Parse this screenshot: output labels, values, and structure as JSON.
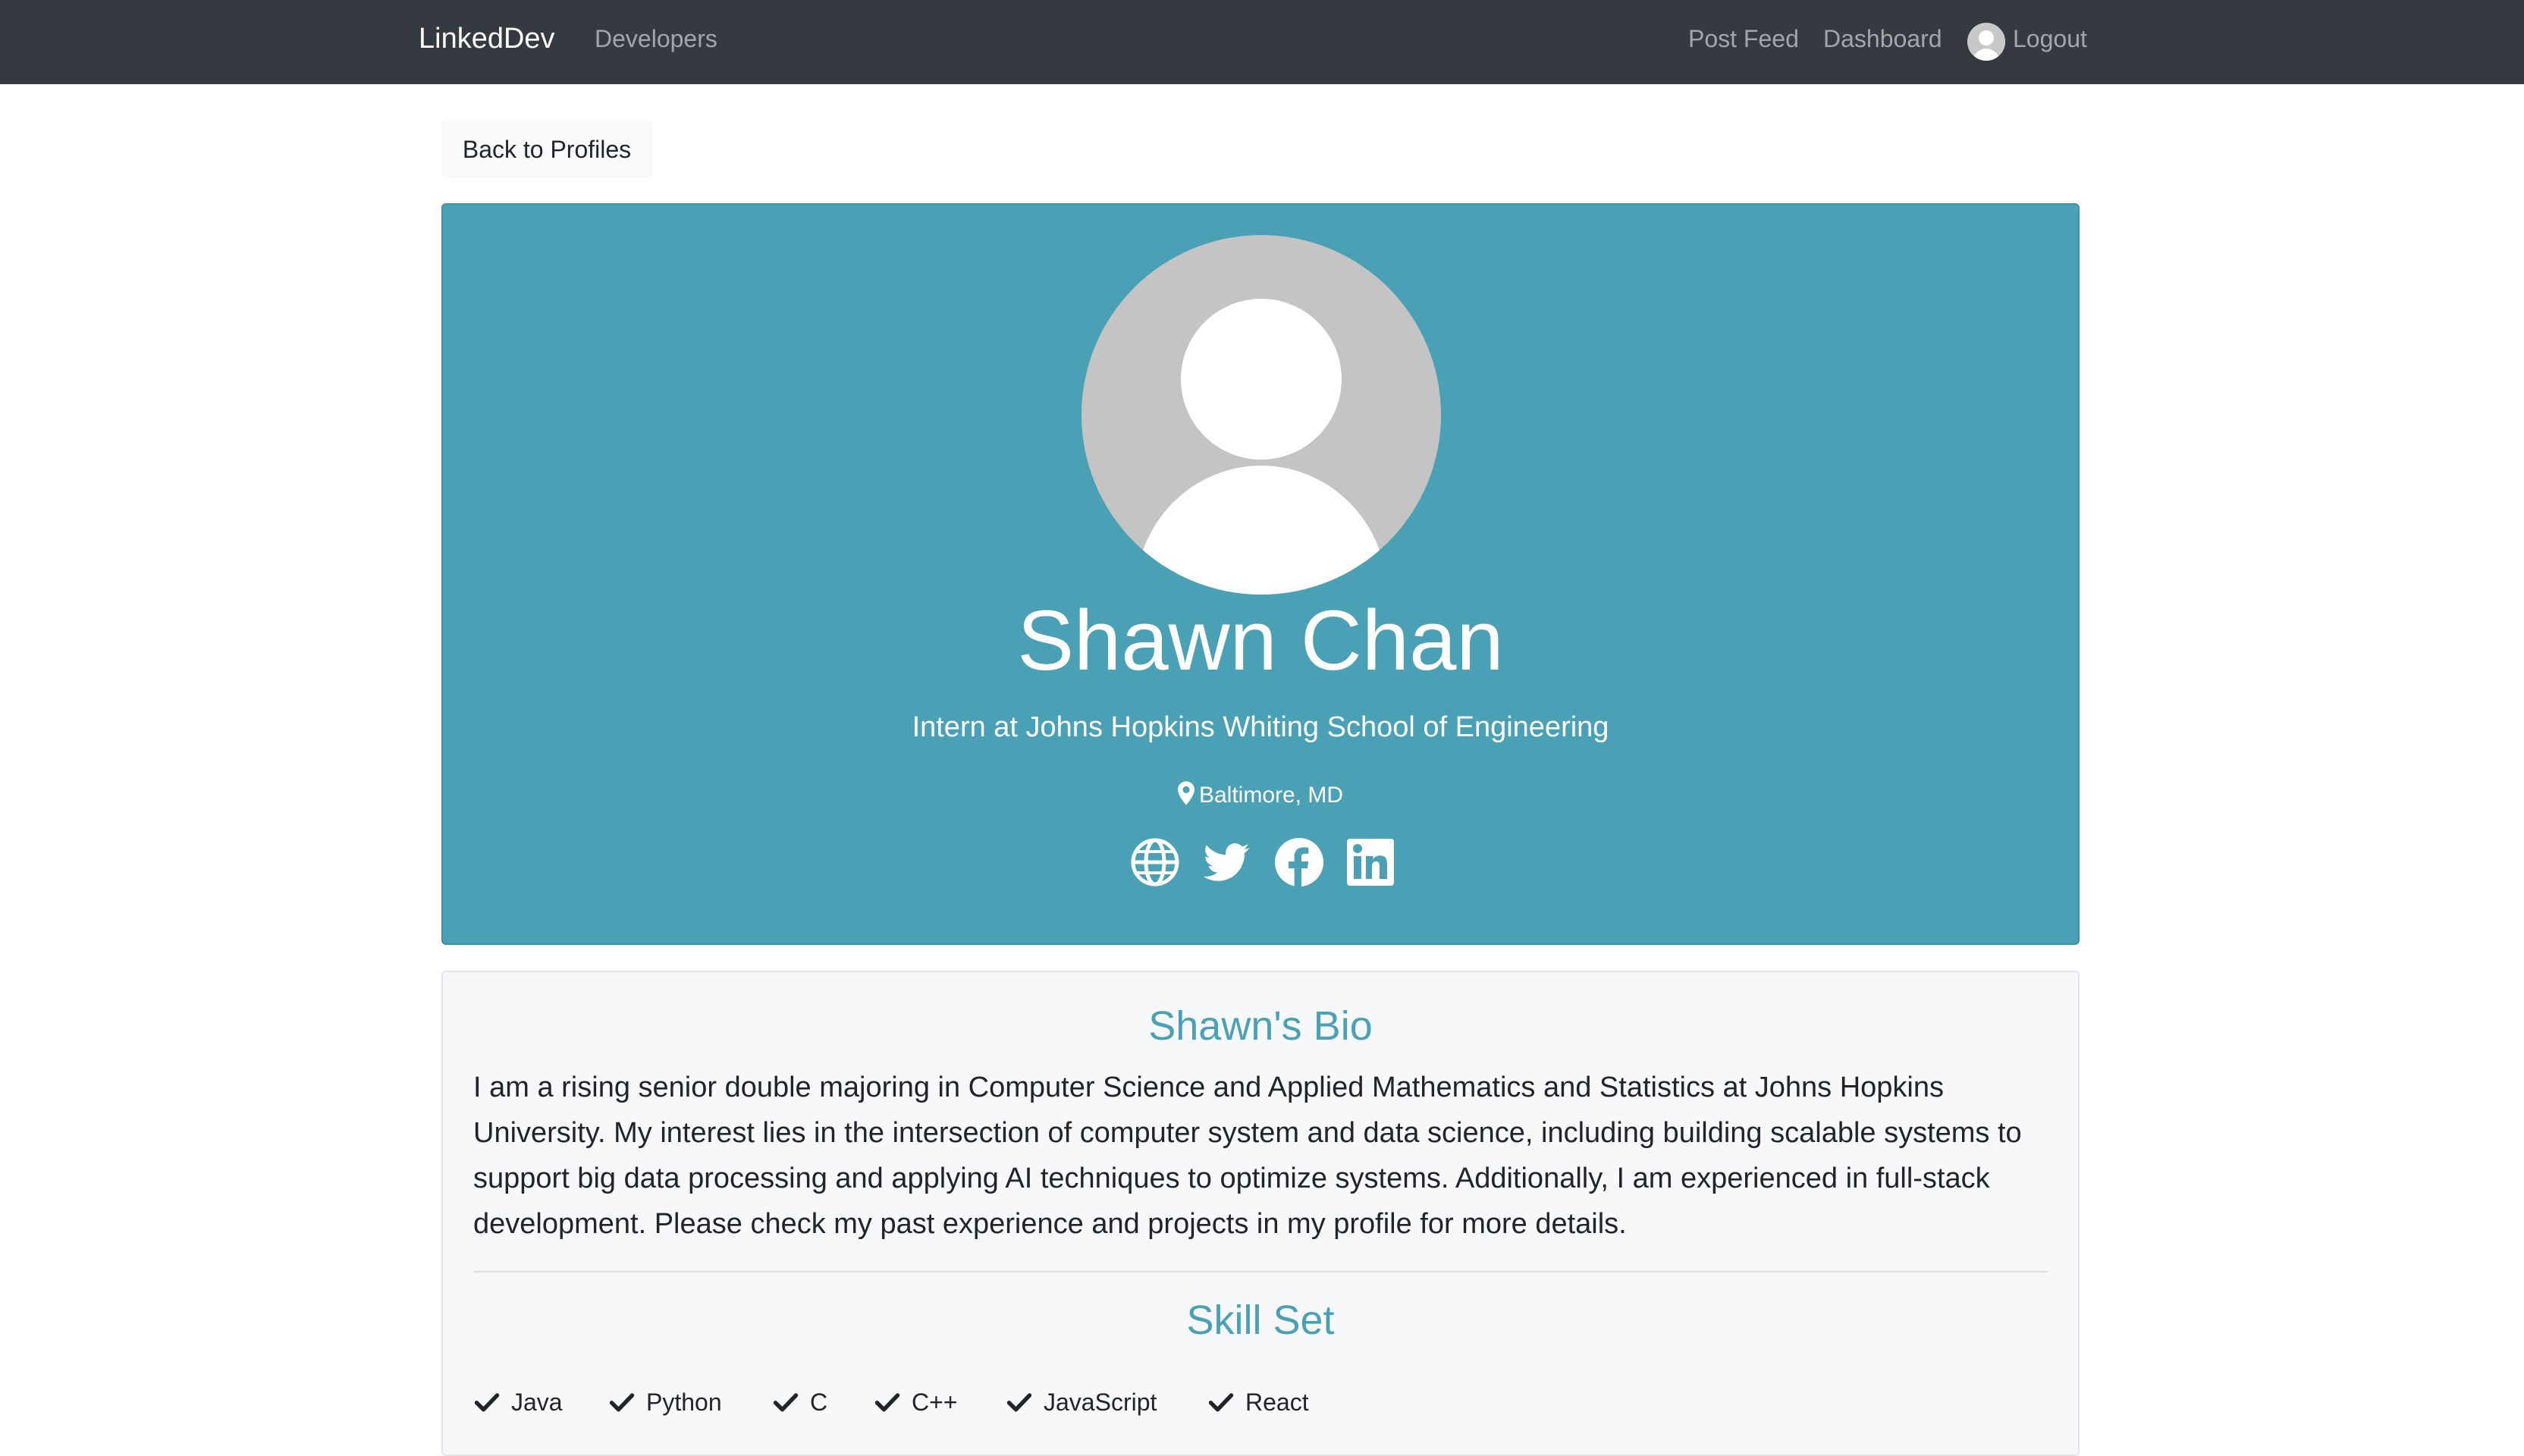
{
  "navbar": {
    "brand": "LinkedDev",
    "developers": "Developers",
    "post_feed": "Post Feed",
    "dashboard": "Dashboard",
    "logout": "Logout",
    "bg_color": "#343a40"
  },
  "back_button": "Back to Profiles",
  "profile": {
    "name": "Shawn Chan",
    "title": "Intern at Johns Hopkins Whiting School of Engineering",
    "location": "Baltimore, MD",
    "social_icons": [
      "globe-icon",
      "twitter-icon",
      "facebook-icon",
      "linkedin-icon"
    ],
    "accent_color": "#4aa0b5"
  },
  "bio": {
    "heading": "Shawn's Bio",
    "lines": [
      "I am a rising senior double majoring in Computer Science and Applied Mathematics and Statistics at Johns Hopkins",
      "University. My interest lies in the intersection of computer system and data science, including building scalable systems to",
      "support big data processing and applying AI techniques to optimize systems. Additionally, I am experienced in full-stack",
      "development. Please check my past experience and projects in my profile for more details."
    ]
  },
  "skills": {
    "heading": "Skill Set",
    "items": [
      "Java",
      "Python",
      "C",
      "C++",
      "JavaScript",
      "React"
    ]
  }
}
